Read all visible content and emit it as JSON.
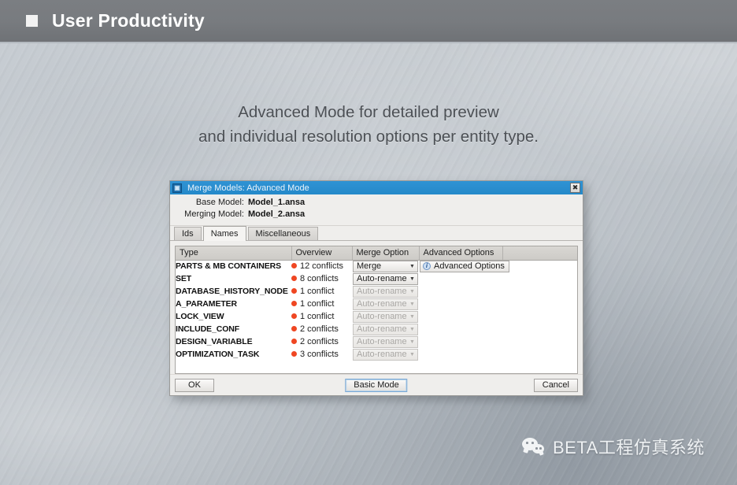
{
  "header": {
    "title": "User Productivity",
    "bullet_icon": "square-bullet-icon",
    "bar_color": "#787b7f",
    "title_color": "#ffffff"
  },
  "caption": {
    "line1": "Advanced Mode for detailed preview",
    "line2": "and individual resolution options per entity type.",
    "color": "#4c5055"
  },
  "dialog": {
    "titlebar": {
      "icon": "merge-models-icon",
      "title": "Merge Models: Advanced Mode",
      "close_label": "✖",
      "close_icon": "close-icon",
      "accent_color": "#2b8ecf"
    },
    "models": [
      {
        "label": "Base Model:",
        "value": "Model_1.ansa"
      },
      {
        "label": "Merging Model:",
        "value": "Model_2.ansa"
      }
    ],
    "tabs": [
      {
        "label": "Ids",
        "active": false
      },
      {
        "label": "Names",
        "active": true
      },
      {
        "label": "Miscellaneous",
        "active": false
      }
    ],
    "table": {
      "columns": [
        "Type",
        "Overview",
        "Merge Option",
        "Advanced Options",
        ""
      ],
      "conflict_dot_color": "#ef4622",
      "rows": [
        {
          "type": "PARTS & MB CONTAINERS",
          "overview": "12 conflicts",
          "merge_option": "Merge",
          "merge_option_enabled": true,
          "advanced_options": "Advanced Options",
          "has_advanced": true
        },
        {
          "type": "SET",
          "overview": "8 conflicts",
          "merge_option": "Auto-rename",
          "merge_option_enabled": true,
          "advanced_options": "",
          "has_advanced": false
        },
        {
          "type": "DATABASE_HISTORY_NODE",
          "overview": "1 conflict",
          "merge_option": "Auto-rename",
          "merge_option_enabled": false,
          "advanced_options": "",
          "has_advanced": false
        },
        {
          "type": "A_PARAMETER",
          "overview": "1 conflict",
          "merge_option": "Auto-rename",
          "merge_option_enabled": false,
          "advanced_options": "",
          "has_advanced": false
        },
        {
          "type": "LOCK_VIEW",
          "overview": "1 conflict",
          "merge_option": "Auto-rename",
          "merge_option_enabled": false,
          "advanced_options": "",
          "has_advanced": false
        },
        {
          "type": "INCLUDE_CONF",
          "overview": "2 conflicts",
          "merge_option": "Auto-rename",
          "merge_option_enabled": false,
          "advanced_options": "",
          "has_advanced": false
        },
        {
          "type": "DESIGN_VARIABLE",
          "overview": "2 conflicts",
          "merge_option": "Auto-rename",
          "merge_option_enabled": false,
          "advanced_options": "",
          "has_advanced": false
        },
        {
          "type": "OPTIMIZATION_TASK",
          "overview": "3 conflicts",
          "merge_option": "Auto-rename",
          "merge_option_enabled": false,
          "advanced_options": "",
          "has_advanced": false
        }
      ]
    },
    "footer": {
      "ok_label": "OK",
      "basic_mode_label": "Basic Mode",
      "cancel_label": "Cancel"
    }
  },
  "watermark": {
    "icon": "wechat-logo-icon",
    "text": "BETA工程仿真系统"
  }
}
